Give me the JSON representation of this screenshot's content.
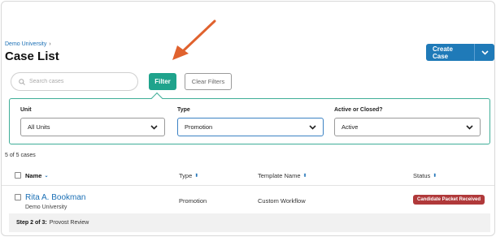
{
  "breadcrumb": {
    "parent": "Demo University",
    "separator": "›"
  },
  "page": {
    "title": "Case List"
  },
  "create_case": {
    "label": "Create Case",
    "caret_icon": "chevron-down-icon"
  },
  "search": {
    "placeholder": "Search cases",
    "value": "",
    "icon": "search-icon"
  },
  "toolbar": {
    "filter_label": "Filter",
    "clear_label": "Clear Filters"
  },
  "filters": {
    "unit": {
      "label": "Unit",
      "value": "All Units"
    },
    "type": {
      "label": "Type",
      "value": "Promotion"
    },
    "active": {
      "label": "Active or Closed?",
      "value": "Active"
    }
  },
  "results": {
    "count_text": "5 of 5 cases"
  },
  "table": {
    "columns": [
      {
        "label": "Name",
        "sort": "⌄"
      },
      {
        "label": "Type",
        "sort": "⬍"
      },
      {
        "label": "Template Name",
        "sort": "⬍"
      },
      {
        "label": "Status",
        "sort": "⬍"
      }
    ],
    "rows": [
      {
        "name": "Rita A. Bookman",
        "unit": "Demo University",
        "type": "Promotion",
        "template": "Custom Workflow",
        "status": "Candidate Packet Received",
        "step_prefix": "Step 2 of 3:",
        "step_name": "Provost Review"
      }
    ]
  },
  "colors": {
    "primary": "#1f7ab8",
    "accent": "#1fa38c",
    "panel_border": "#3fae98",
    "status_badge": "#b0393a",
    "annotation_arrow": "#e0622e"
  }
}
